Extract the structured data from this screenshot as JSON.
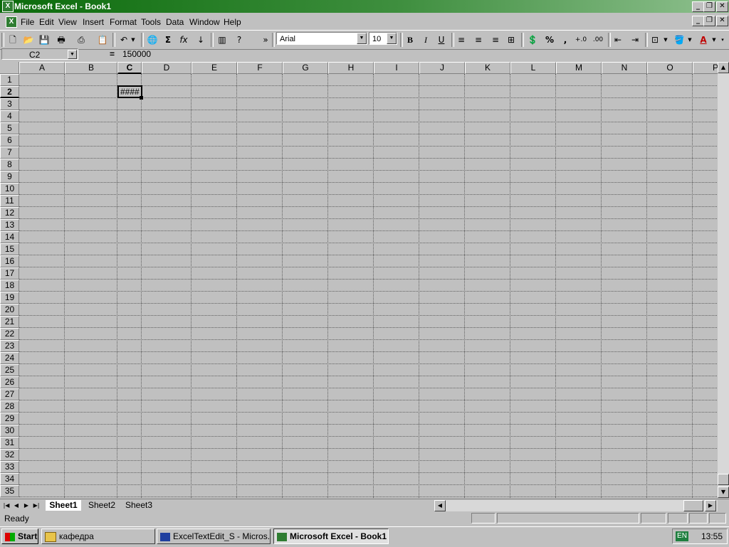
{
  "window": {
    "title": "Microsoft Excel - Book1"
  },
  "menu": [
    "File",
    "Edit",
    "View",
    "Insert",
    "Format",
    "Tools",
    "Data",
    "Window",
    "Help"
  ],
  "toolbar": {
    "font_name": "Arial",
    "font_size": "10",
    "more_glyph": "»"
  },
  "formula_bar": {
    "name_box": "C2",
    "equals": "=",
    "value": "150000"
  },
  "sheet": {
    "columns": [
      "A",
      "B",
      "C",
      "D",
      "E",
      "F",
      "G",
      "H",
      "I",
      "J",
      "K",
      "L",
      "M",
      "N",
      "O",
      "P"
    ],
    "rows": [
      "1",
      "2",
      "3",
      "4",
      "5",
      "6",
      "7",
      "8",
      "9",
      "10",
      "11",
      "12",
      "13",
      "14",
      "15",
      "16",
      "17",
      "18",
      "19",
      "20",
      "21",
      "22",
      "23",
      "24",
      "25",
      "26",
      "27",
      "28",
      "29",
      "30",
      "31",
      "32",
      "33",
      "34",
      "35"
    ],
    "active_cell_display": "####",
    "tabs": [
      "Sheet1",
      "Sheet2",
      "Sheet3"
    ]
  },
  "status": {
    "text": "Ready"
  },
  "taskbar": {
    "start": "Start",
    "items": [
      "кафедра",
      "ExcelTextEdit_S - Micros...",
      "Microsoft Excel - Book1"
    ],
    "lang": "EN",
    "clock": "13:55"
  },
  "colors": {
    "title_start": "#0b6b0b",
    "title_end": "#8fc08f",
    "face": "#c0c0c0"
  }
}
